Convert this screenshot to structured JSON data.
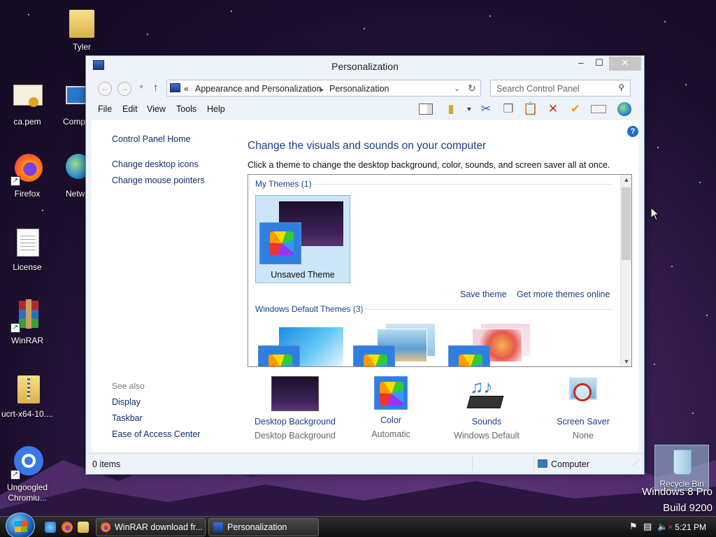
{
  "desktop": {
    "icons": [
      {
        "label": "Tyler"
      },
      {
        "label": "ca.pem"
      },
      {
        "label": "Comp"
      },
      {
        "label": "Firefox"
      },
      {
        "label": "Netw"
      },
      {
        "label": "License"
      },
      {
        "label": "WinRAR"
      },
      {
        "label": "ucrt-x64-10...."
      },
      {
        "label": "Ungoogled Chromiu..."
      },
      {
        "label": "Recycle Bin"
      }
    ],
    "watermark": {
      "line1": "Windows 8 Pro",
      "line2": "Build 9200"
    }
  },
  "window": {
    "title": "Personalization",
    "controls": {
      "minimize": "‒",
      "maximize": "☐",
      "close": "✕"
    },
    "address": {
      "chevron": "«",
      "crumbs": [
        "Appearance and Personalization",
        "Personalization"
      ],
      "separator": "▸"
    },
    "search": {
      "placeholder": "Search Control Panel"
    },
    "menu": [
      "File",
      "Edit",
      "View",
      "Tools",
      "Help"
    ],
    "sidebar": {
      "home": "Control Panel Home",
      "links": [
        "Change desktop icons",
        "Change mouse pointers"
      ],
      "see_also_title": "See also",
      "see_also": [
        "Display",
        "Taskbar",
        "Ease of Access Center"
      ]
    },
    "main": {
      "heading": "Change the visuals and sounds on your computer",
      "subheading": "Click a theme to change the desktop background, color, sounds, and screen saver all at once.",
      "my_themes_title": "My Themes (1)",
      "unsaved_theme": "Unsaved Theme",
      "save_theme": "Save theme",
      "get_more": "Get more themes online",
      "default_themes_title": "Windows Default Themes (3)"
    },
    "bottom_items": [
      {
        "name": "Desktop Background",
        "value": "Desktop Background"
      },
      {
        "name": "Color",
        "value": "Automatic"
      },
      {
        "name": "Sounds",
        "value": "Windows Default"
      },
      {
        "name": "Screen Saver",
        "value": "None"
      }
    ],
    "status": {
      "items": "0 items",
      "location": "Computer"
    }
  },
  "taskbar": {
    "tasks": [
      {
        "label": "WinRAR download fr..."
      },
      {
        "label": "Personalization"
      }
    ],
    "clock": "5:21 PM"
  },
  "colors": {
    "link": "#1a3f8c",
    "selection": "#cce6f7",
    "accent": "#1f6fd0"
  }
}
